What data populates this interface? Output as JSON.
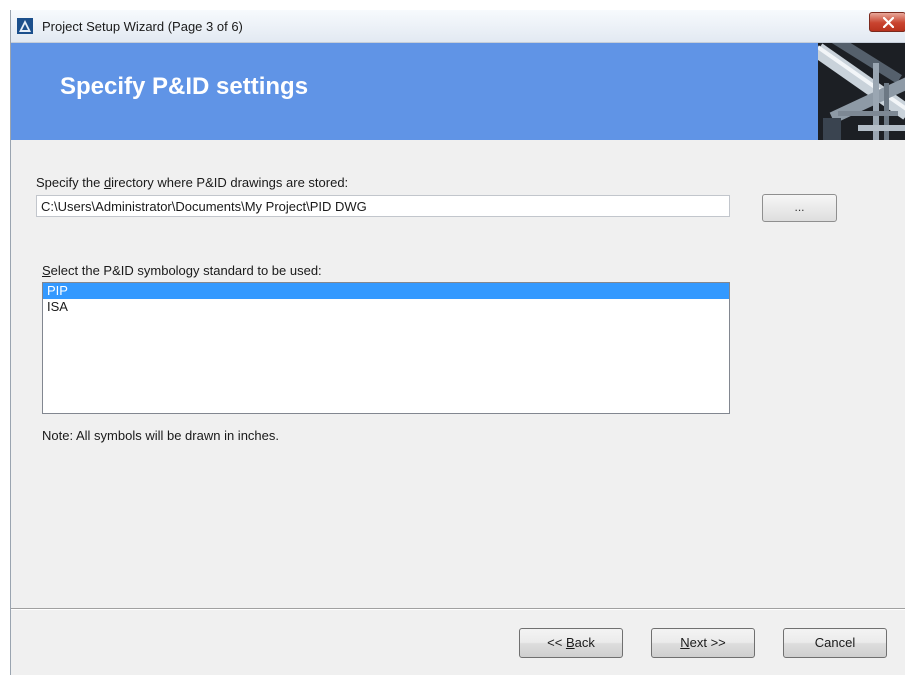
{
  "window": {
    "title": "Project Setup Wizard (Page 3 of 6)",
    "close_label": "×"
  },
  "header": {
    "title": "Specify P&ID settings"
  },
  "directory": {
    "label_pre": "Specify the ",
    "label_accel": "d",
    "label_post": "irectory where P&ID drawings are stored:",
    "value": "C:\\Users\\Administrator\\Documents\\My Project\\PID DWG",
    "browse_label": "..."
  },
  "symbology": {
    "label_accel": "S",
    "label_post": "elect the P&ID symbology standard to be used:",
    "options": [
      "PIP",
      "ISA"
    ],
    "selected": "PIP"
  },
  "note": "Note: All symbols will be drawn in inches.",
  "buttons": {
    "back_pre": "<< ",
    "back_accel": "B",
    "back_post": "ack",
    "next_accel": "N",
    "next_post": "ext >>",
    "cancel": "Cancel"
  },
  "colors": {
    "header_bg": "#6094e6",
    "selection": "#3399ff"
  }
}
